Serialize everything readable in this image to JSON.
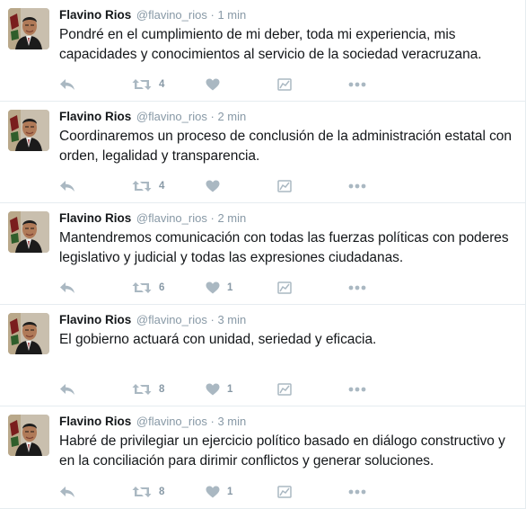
{
  "tweets": [
    {
      "name": "Flavino Rios",
      "handle": "@flavino_rios",
      "dot": "·",
      "time": "1 min",
      "text": "Pondré en el cumplimiento de mi deber, toda mi experiencia, mis capacidades y conocimientos al servicio de la sociedad veracruzana.",
      "retweets": "4",
      "likes": ""
    },
    {
      "name": "Flavino Rios",
      "handle": "@flavino_rios",
      "dot": "·",
      "time": "2 min",
      "text": "Coordinaremos un proceso de conclusión de la administración estatal con orden, legalidad y transparencia.",
      "retweets": "4",
      "likes": ""
    },
    {
      "name": "Flavino Rios",
      "handle": "@flavino_rios",
      "dot": "·",
      "time": "2 min",
      "text": "Mantendremos comunicación con todas las fuerzas políticas con poderes legislativo y judicial y todas las expresiones ciudadanas.",
      "retweets": "6",
      "likes": "1"
    },
    {
      "name": "Flavino Rios",
      "handle": "@flavino_rios",
      "dot": "·",
      "time": "3 min",
      "text": "El gobierno actuará con unidad, seriedad y eficacia.",
      "retweets": "8",
      "likes": "1"
    },
    {
      "name": "Flavino Rios",
      "handle": "@flavino_rios",
      "dot": "·",
      "time": "3 min",
      "text": "Habré de privilegiar un ejercicio político basado en diálogo constructivo y en la conciliación para dirimir conflictos y generar soluciones.",
      "retweets": "8",
      "likes": "1"
    }
  ],
  "icons": {
    "reply": "reply-icon",
    "retweet": "retweet-icon",
    "like": "heart-icon",
    "poll": "analytics-icon",
    "more": "more-dots-icon"
  },
  "colors": {
    "text": "#14171a",
    "muted": "#8899a6",
    "icon": "#aab8c2",
    "divider": "#e6ecf0"
  }
}
